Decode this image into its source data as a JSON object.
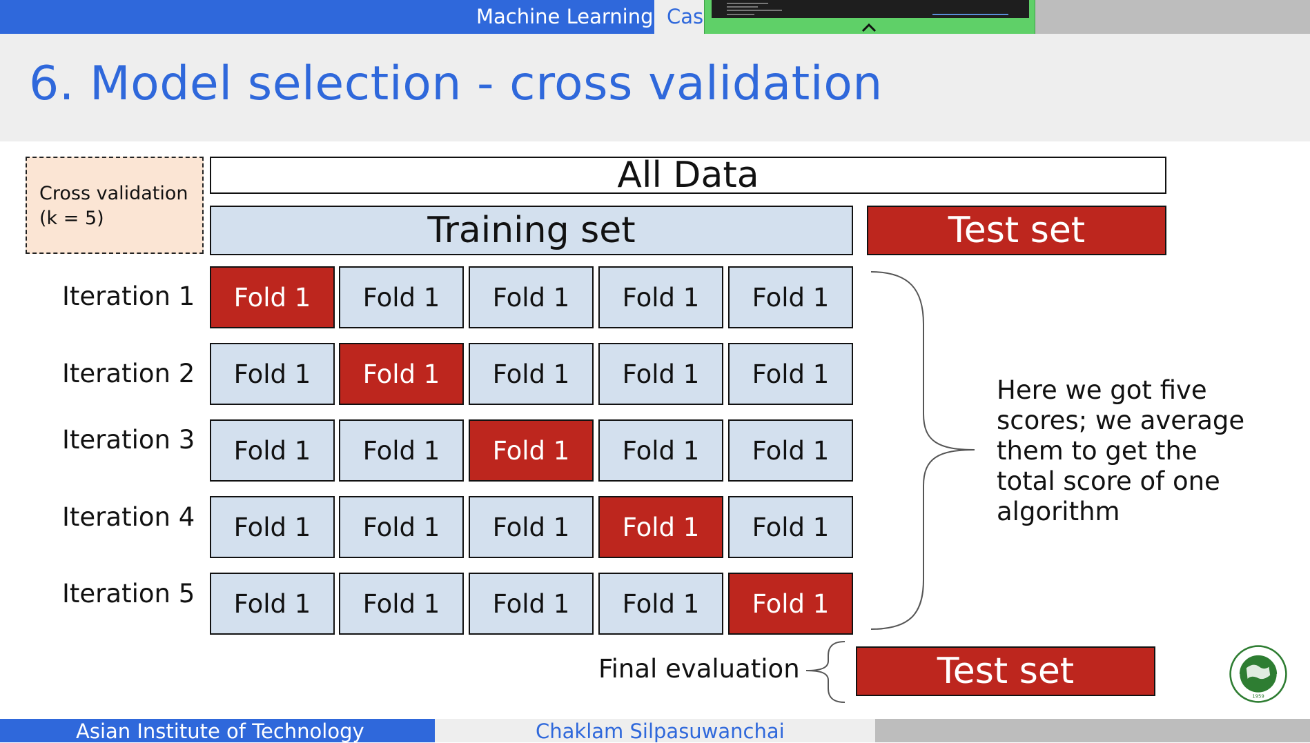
{
  "header": {
    "course": "Machine Learning",
    "next_tab": "Cas"
  },
  "slide": {
    "title": "6. Model selection - cross validation"
  },
  "diagram": {
    "cv_label": "Cross validation (k = 5)",
    "all_data": "All Data",
    "training_set": "Training set",
    "test_set": "Test set",
    "iterations": [
      {
        "label": "Iteration 1",
        "test_fold_index": 0
      },
      {
        "label": "Iteration 2",
        "test_fold_index": 1
      },
      {
        "label": "Iteration 3",
        "test_fold_index": 2
      },
      {
        "label": "Iteration 4",
        "test_fold_index": 3
      },
      {
        "label": "Iteration 5",
        "test_fold_index": 4
      }
    ],
    "fold_label": "Fold 1",
    "summary": "Here we got five scores; we average them to get the total score of one algorithm",
    "final_evaluation": "Final evaluation",
    "final_test_set": "Test set",
    "colors": {
      "training": "#d3e0ee",
      "test": "#bd261e",
      "accent": "#2f68db"
    }
  },
  "footer": {
    "institution": "Asian Institute of Technology",
    "author": "Chaklam Silpasuwanchai"
  },
  "logo": {
    "icon": "ait-seal-logo",
    "ring_text": "ASIAN INSTITUTE OF TECHNOLOGY",
    "year": "1959"
  }
}
